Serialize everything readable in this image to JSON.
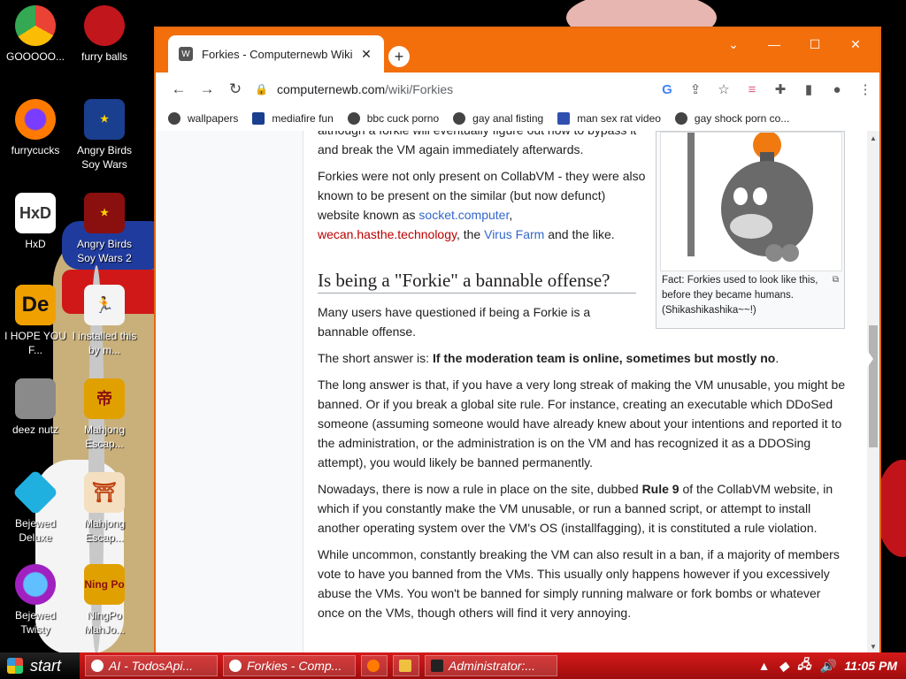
{
  "window": {
    "tab_title": "Forkies - Computernewb Wiki",
    "url_host": "computernewb.com",
    "url_path": "/wiki/Forkies"
  },
  "desktop_icons": [
    {
      "label": "GOOOOO...",
      "color": "#ffffff"
    },
    {
      "label": "furry balls",
      "color": "#c0161c"
    },
    {
      "label": "furrycucks",
      "color": "#ff7a00"
    },
    {
      "label": "Angry Birds Soy Wars",
      "color": "#1a3f8f"
    },
    {
      "label": "HxD",
      "color": "#ffffff"
    },
    {
      "label": "Angry Birds Soy Wars 2",
      "color": "#8a1010"
    },
    {
      "label": "I HOPE YOU F...",
      "color": "#f0a000"
    },
    {
      "label": "I installed this by m...",
      "color": "#ffffff"
    },
    {
      "label": "deez nutz",
      "color": "#8a8a8a"
    },
    {
      "label": "Mahjong Escap...",
      "color": "#e0a000"
    },
    {
      "label": "Bejewed Deluxe",
      "color": "#20b0e0"
    },
    {
      "label": "Mahjong Escap...",
      "color": "#c04010"
    },
    {
      "label": "Bejewed Twisty",
      "color": "#a020c0"
    },
    {
      "label": "NingPo MahJo...",
      "color": "#e0a000"
    }
  ],
  "bookmarks": [
    "wallpapers",
    "mediafire fun",
    "bbc cuck porno",
    "gay anal fisting",
    "man sex rat video",
    "gay shock porn co..."
  ],
  "article": {
    "p0": "although a forkie will eventually figure out how to bypass it and break the VM again immediately afterwards.",
    "p1_a": "Forkies were not only present on CollabVM - they were also known to be present on the similar (but now defunct) website known as ",
    "p1_link1": "socket.computer",
    "p1_comma": ",",
    "p1_link2": "wecan.hasthe.technology",
    "p1_mid": ", the ",
    "p1_link3": "Virus Farm",
    "p1_end": " and the like.",
    "heading": "Is being a \"Forkie\" a bannable offense?",
    "p2": "Many users have questioned if being a Forkie is a bannable offense.",
    "p3_a": "The short answer is: ",
    "p3_b": "If the moderation team is online, sometimes but mostly no",
    "p3_c": ".",
    "p4": "The long answer is that, if you have a very long streak of making the VM unusable, you might be banned. Or if you break a global site rule. For instance, creating an executable which DDoSed someone (assuming someone would have already knew about your intentions and reported it to the administration, or the administration is on the VM and has recognized it as a DDOSing attempt), you would likely be banned permanently.",
    "p5_a": "Nowadays, there is now a rule in place on the site, dubbed ",
    "p5_b": "Rule 9",
    "p5_c": " of the CollabVM website, in which if you constantly make the VM unusable, or run a banned script, or attempt to install another operating system over the VM's OS (installfagging), it is constituted a rule violation.",
    "p6": "While uncommon, constantly breaking the VM can also result in a ban, if a majority of members vote to have you banned from the VMs. This usually only happens however if you excessively abuse the VMs. You won't be banned for simply running malware or fork bombs or whatever once on the VMs, though others will find it very annoying.",
    "caption": "Fact: Forkies used to look like this, before they became humans. (Shikashikashika~~!)"
  },
  "taskbar": {
    "start": "start",
    "tasks": [
      "AI - TodosApi...",
      "Forkies - Comp...",
      "Administrator:..."
    ],
    "clock": "11:05 PM"
  }
}
